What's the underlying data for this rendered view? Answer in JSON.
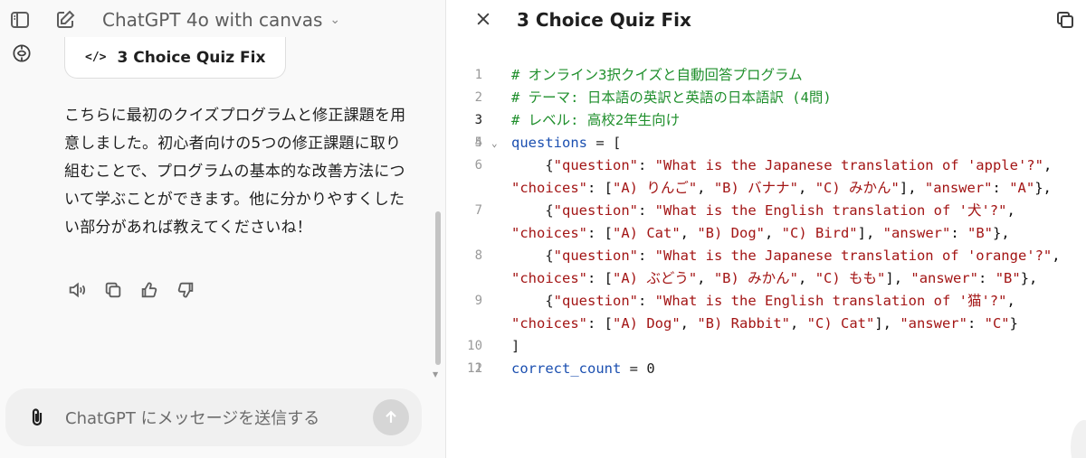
{
  "header": {
    "model_title": "ChatGPT 4o with canvas"
  },
  "chat": {
    "canvas_card": {
      "icon": "</>",
      "label": "3 Choice Quiz Fix"
    },
    "message": "こちらに最初のクイズプログラムと修正課題を用意しました。初心者向けの5つの修正課題に取り組むことで、プログラムの基本的な改善方法について学ぶことができます。他に分かりやすくしたい部分があれば教えてくださいね！",
    "actions": [
      "read-aloud-icon",
      "copy-icon",
      "thumbs-up-icon",
      "thumbs-down-icon"
    ]
  },
  "composer": {
    "placeholder": "ChatGPT にメッセージを送信する"
  },
  "canvas": {
    "title": "3 Choice Quiz Fix",
    "code_lines": [
      {
        "n": "1",
        "text": "# オンライン3択クイズと自動回答プログラム",
        "kind": "comment"
      },
      {
        "n": "2",
        "text": "# テーマ: 日本語の英訳と英語の日本語訳 (4問)",
        "kind": "comment"
      },
      {
        "n": "3",
        "text": "# レベル: 高校2年生向け",
        "kind": "comment",
        "active": true
      },
      {
        "n": "4",
        "text": "",
        "kind": "plain"
      },
      {
        "n": "5",
        "text": "questions = [",
        "kind": "assign",
        "fold": true
      },
      {
        "n": "6",
        "text": "    {\"question\": \"What is the Japanese translation of 'apple'?\", \"choices\": [\"A) りんご\", \"B) バナナ\", \"C) みかん\"], \"answer\": \"A\"},",
        "kind": "string"
      },
      {
        "n": "7",
        "text": "    {\"question\": \"What is the English translation of '犬'?\", \"choices\": [\"A) Cat\", \"B) Dog\", \"C) Bird\"], \"answer\": \"B\"},",
        "kind": "string"
      },
      {
        "n": "8",
        "text": "    {\"question\": \"What is the Japanese translation of 'orange'?\", \"choices\": [\"A) ぶどう\", \"B) みかん\", \"C) もも\"], \"answer\": \"B\"},",
        "kind": "string"
      },
      {
        "n": "9",
        "text": "    {\"question\": \"What is the English translation of '猫'?\", \"choices\": [\"A) Dog\", \"B) Rabbit\", \"C) Cat\"], \"answer\": \"C\"}",
        "kind": "string"
      },
      {
        "n": "10",
        "text": "]",
        "kind": "plain"
      },
      {
        "n": "11",
        "text": "",
        "kind": "plain"
      },
      {
        "n": "12",
        "text": "correct_count = 0",
        "kind": "assign"
      }
    ]
  },
  "colors": {
    "comment": "#1f8f2c",
    "variable": "#1b4fb0",
    "string": "#a31515",
    "sidebar_bg": "#f9f9f9"
  }
}
